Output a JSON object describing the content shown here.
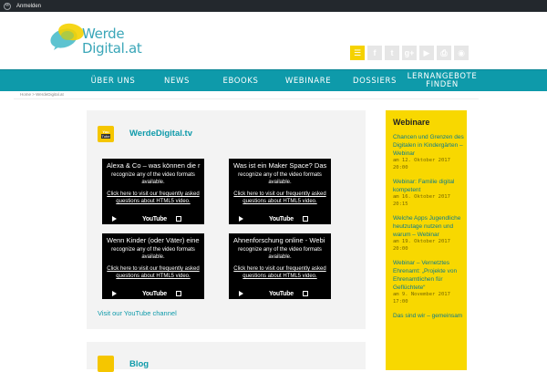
{
  "adminbar": {
    "login_label": "Anmelden"
  },
  "logo": {
    "line1": "Werde",
    "line2": "Digital.at"
  },
  "social": [
    "list-icon",
    "facebook-icon",
    "twitter-icon",
    "googleplus-icon",
    "youtube-icon",
    "print-icon",
    "rss-icon"
  ],
  "nav": [
    {
      "label": "ÜBER UNS"
    },
    {
      "label": "NEWS"
    },
    {
      "label": "EBOOKS"
    },
    {
      "label": "WEBINARE"
    },
    {
      "label": "DOSSIERS"
    },
    {
      "label": "LERNANGEBOTE FINDEN"
    }
  ],
  "breadcrumb": "Home > WerdeDigital.at",
  "youtube_section": {
    "title": "WerdeDigital.tv",
    "icon_top": "You",
    "icon_bottom": "Tube",
    "videos": [
      {
        "title": "Alexa & Co – was können die r",
        "message": "recognize any of the video formats available.",
        "link": "Click here to visit our frequently asked questions about HTML5 video.",
        "logo": "YouTube"
      },
      {
        "title": "Was ist ein Maker Space? Das",
        "message": "recognize any of the video formats available.",
        "link": "Click here to visit our frequently asked questions about HTML5 video.",
        "logo": "YouTube"
      },
      {
        "title": "Wenn Kinder (oder Väter) eine",
        "message": "recognize any of the video formats available.",
        "link": "Click here to visit our frequently asked questions about HTML5 video.",
        "logo": "YouTube"
      },
      {
        "title": "Ahnenforschung online - Webi",
        "message": "recognize any of the video formats available.",
        "link": "Click here to visit our frequently asked questions about HTML5 video.",
        "logo": "YouTube"
      }
    ],
    "channel_link": "Visit our YouTube channel"
  },
  "blog_section": {
    "title": "Blog"
  },
  "sidebar": {
    "title": "Webinare",
    "items": [
      {
        "title": "Chancen und Grenzen des Digitalen in Kindergärten – Webinar",
        "date": "am 12. Oktober 2017 20:00"
      },
      {
        "title": "Webinar: Familie digital kompetent",
        "date": "am 16. Oktober 2017 20:15"
      },
      {
        "title": "Welche Apps Jugendliche heutzutage nutzen und warum – Webinar",
        "date": "am 19. Oktober 2017 20:00"
      },
      {
        "title": "Webinar – Vernetztes Ehrenamt: „Projekte von Ehrenamtlichen für Geflüchtete“",
        "date": "am 9. November 2017 17:00"
      },
      {
        "title": "Das sind wir – gemeinsam",
        "date": ""
      }
    ]
  },
  "colors": {
    "brand_teal": "#0e9aaa",
    "accent_yellow": "#f8d800",
    "admin_bar": "#23282d"
  }
}
